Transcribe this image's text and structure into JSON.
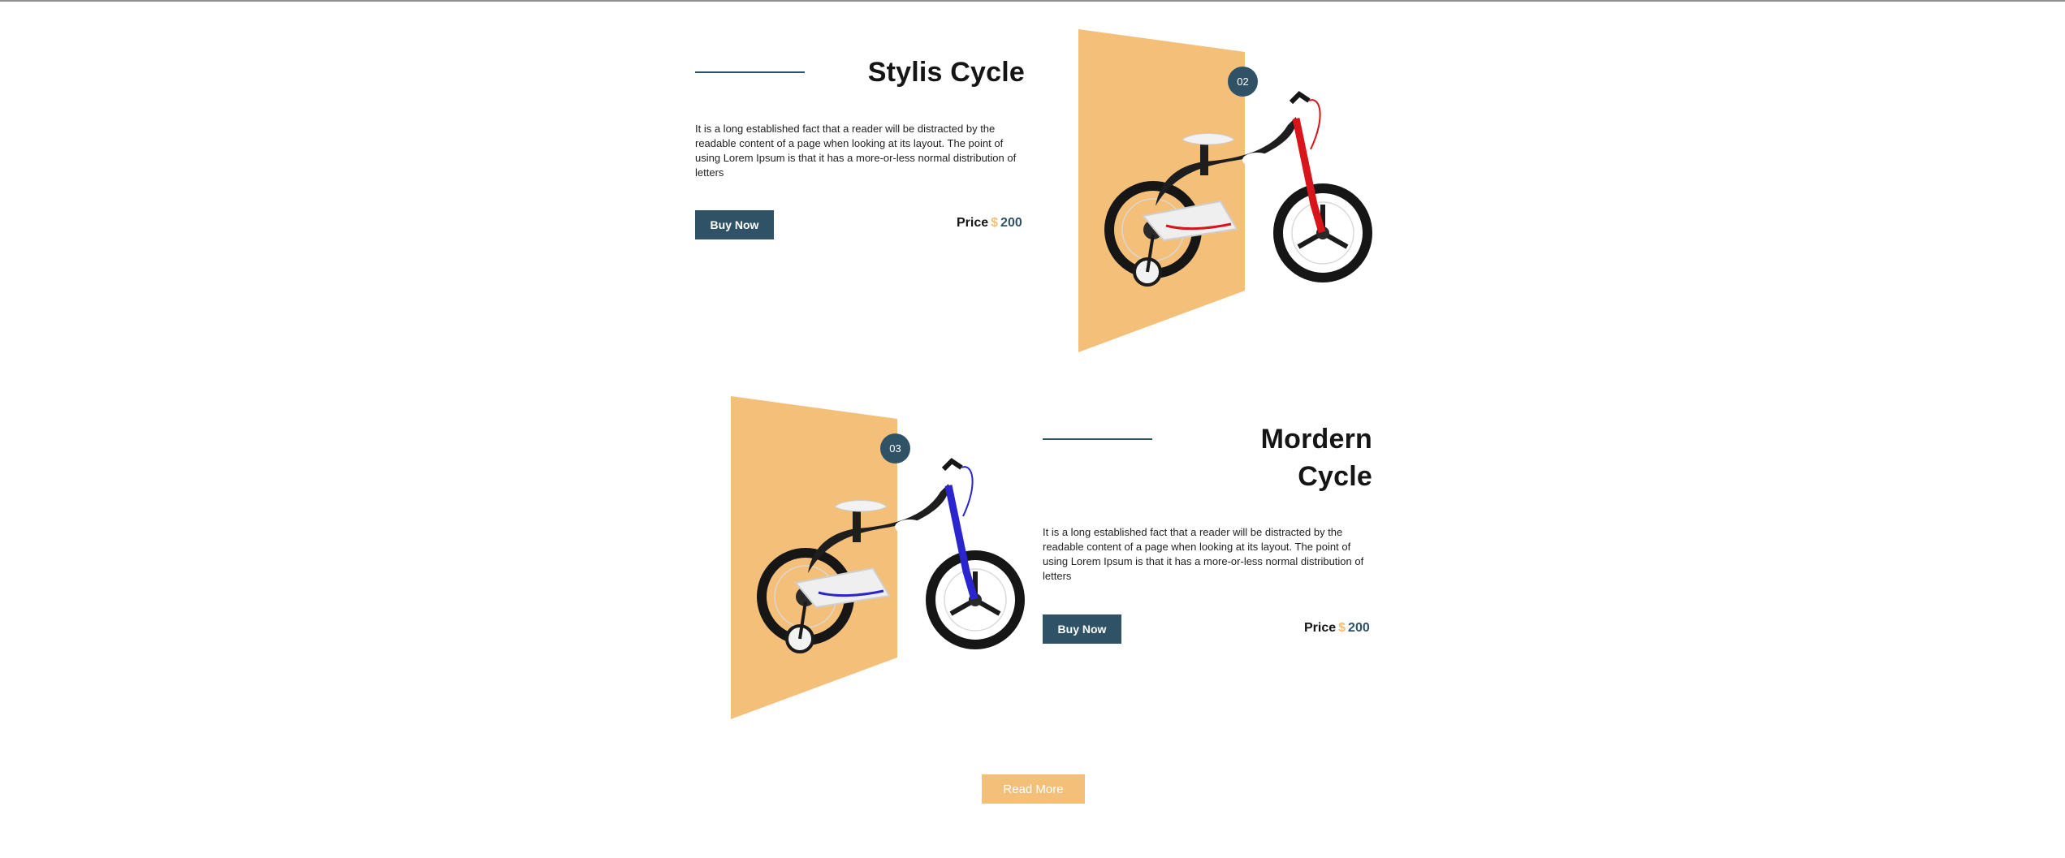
{
  "products": [
    {
      "number": "02",
      "title_lines": [
        "Stylis Cycle"
      ],
      "description": "It is a long established fact that a reader will be distracted by the readable content of a page when looking at its layout. The point of using Lorem Ipsum is that it has a more-or-less normal distribution of letters",
      "buy_label": "Buy Now",
      "price_label": "Price",
      "currency": "$",
      "price": "200",
      "accent_color": "#d8151a"
    },
    {
      "number": "03",
      "title_lines": [
        "Mordern",
        "Cycle"
      ],
      "description": "It is a long established fact that a reader will be distracted by the readable content of a page when looking at its layout. The point of using Lorem Ipsum is that it has a more-or-less normal distribution of letters",
      "buy_label": "Buy Now",
      "price_label": "Price",
      "currency": "$",
      "price": "200",
      "accent_color": "#2a25cf"
    }
  ],
  "read_more_label": "Read More",
  "colors": {
    "primary": "#2f5266",
    "panel": "#f4bf79",
    "text": "#151515"
  }
}
